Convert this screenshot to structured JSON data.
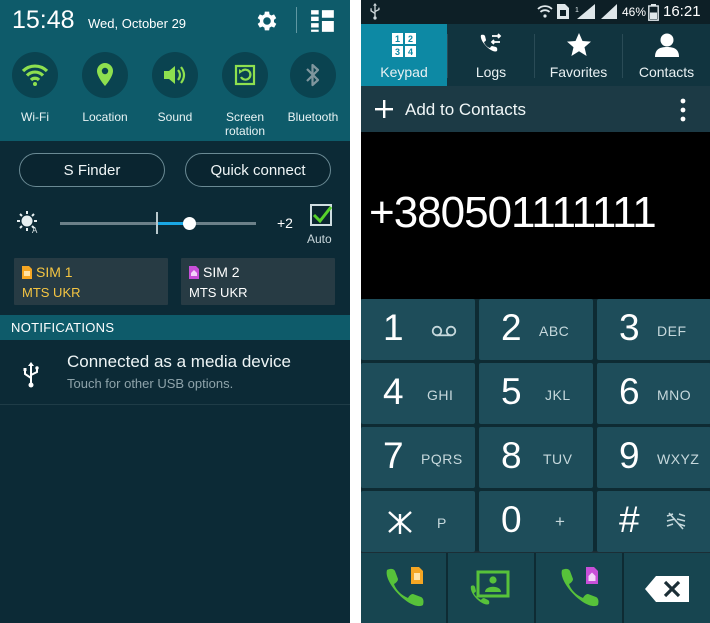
{
  "left_panel": {
    "time": "15:48",
    "date": "Wed, October 29",
    "toggles": [
      {
        "label": "Wi-Fi",
        "icon": "wifi-icon",
        "active": true
      },
      {
        "label": "Location",
        "icon": "location-icon",
        "active": true
      },
      {
        "label": "Sound",
        "icon": "sound-icon",
        "active": true
      },
      {
        "label": "Screen rotation",
        "icon": "screen-rotation-icon",
        "active": true
      },
      {
        "label": "Bluetooth",
        "icon": "bluetooth-icon",
        "active": false
      }
    ],
    "buttons": {
      "s_finder": "S Finder",
      "quick_connect": "Quick connect"
    },
    "brightness": {
      "value_label": "+2",
      "auto_label": "Auto",
      "auto_checked": true,
      "level": 0.66
    },
    "sims": [
      {
        "name": "SIM 1",
        "operator": "MTS UKR",
        "color": "#f5a623"
      },
      {
        "name": "SIM 2",
        "operator": "MTS UKR",
        "color": "#c84fd8"
      }
    ],
    "notifications_header": "NOTIFICATIONS",
    "notification": {
      "title": "Connected as a media device",
      "subtitle": "Touch for other USB options.",
      "icon": "usb-icon"
    }
  },
  "right_panel": {
    "status_bar": {
      "battery": "46%",
      "time": "16:21"
    },
    "tabs": [
      {
        "label": "Keypad",
        "icon": "keypad-icon",
        "active": true
      },
      {
        "label": "Logs",
        "icon": "logs-icon",
        "active": false
      },
      {
        "label": "Favorites",
        "icon": "star-icon",
        "active": false
      },
      {
        "label": "Contacts",
        "icon": "contact-icon",
        "active": false
      }
    ],
    "add_to_contacts": "Add to Contacts",
    "dialed_number": "+380501111111",
    "keys": [
      {
        "digit": "1",
        "letters": ""
      },
      {
        "digit": "2",
        "letters": "ABC"
      },
      {
        "digit": "3",
        "letters": "DEF"
      },
      {
        "digit": "4",
        "letters": "GHI"
      },
      {
        "digit": "5",
        "letters": "JKL"
      },
      {
        "digit": "6",
        "letters": "MNO"
      },
      {
        "digit": "7",
        "letters": "PQRS"
      },
      {
        "digit": "8",
        "letters": "TUV"
      },
      {
        "digit": "9",
        "letters": "WXYZ"
      },
      {
        "digit": "",
        "letters": "P"
      },
      {
        "digit": "0",
        "letters": "+"
      },
      {
        "digit": "#",
        "letters": ""
      }
    ],
    "accent_green": "#57c23a",
    "active_tab_color": "#0d89a4"
  }
}
